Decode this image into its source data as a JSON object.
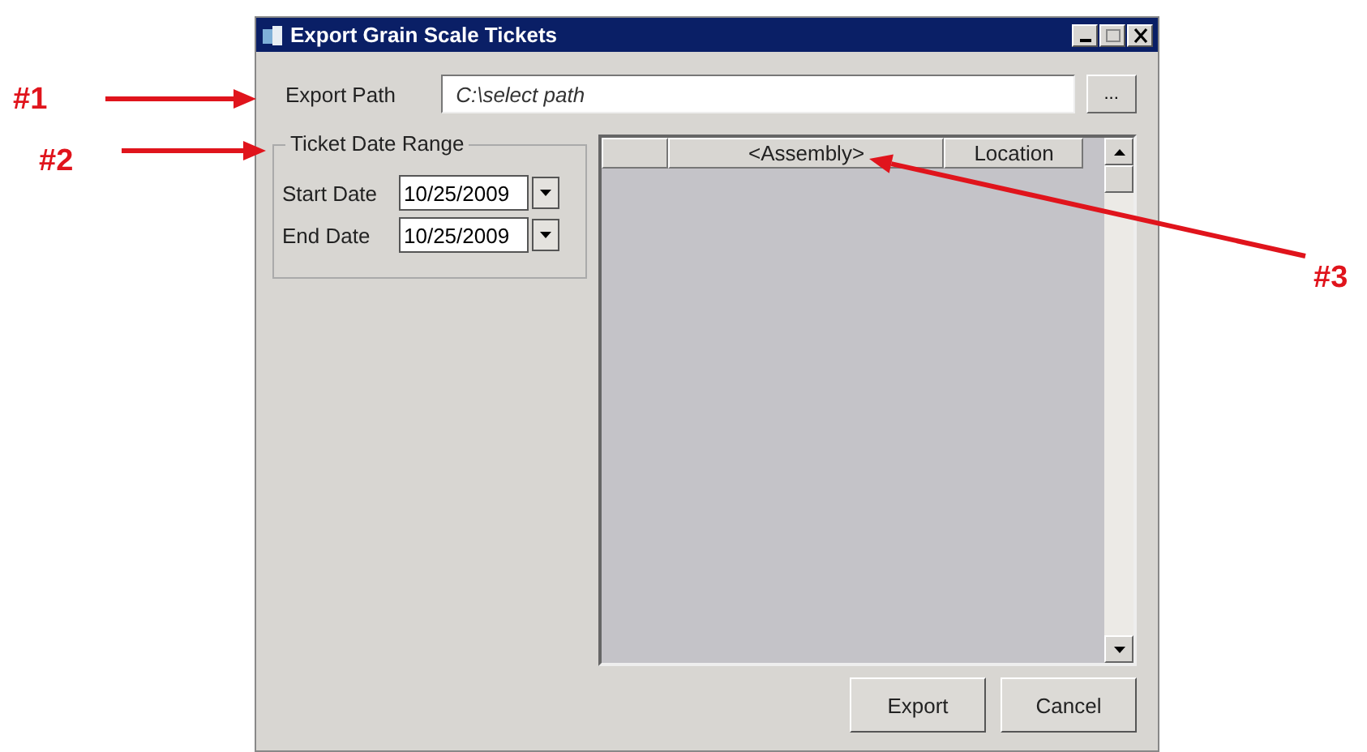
{
  "window": {
    "title": "Export Grain Scale Tickets"
  },
  "export_path": {
    "label": "Export Path",
    "placeholder": "C:\\select path",
    "browse_button": "..."
  },
  "date_range": {
    "title": "Ticket Date Range",
    "fields": [
      {
        "label": "Start Date",
        "value": "10/25/2009"
      },
      {
        "label": "End Date",
        "value": "10/25/2009"
      }
    ]
  },
  "grid": {
    "columns": [
      "",
      "<Assembly>",
      "Location"
    ]
  },
  "buttons": [
    "Export",
    "Cancel"
  ],
  "annotations": [
    {
      "label": "#1"
    },
    {
      "label": "#2"
    },
    {
      "label": "#3"
    }
  ]
}
